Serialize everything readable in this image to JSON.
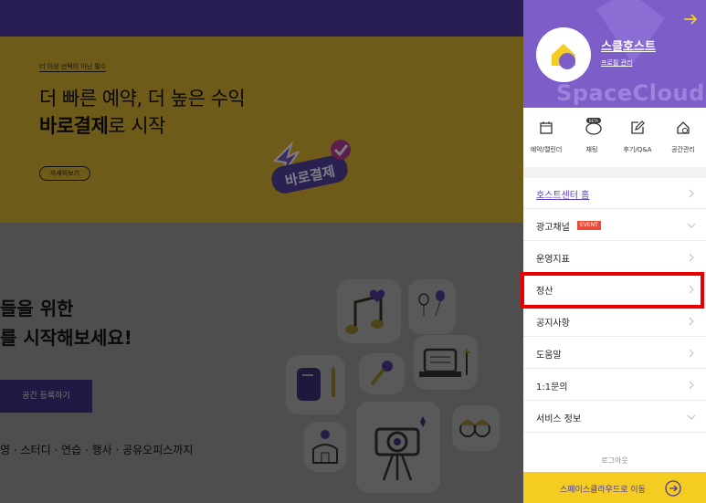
{
  "banner": {
    "tag": "더 이상 선택이 아닌 필수",
    "line1": "더 빠른 예약, 더 높은 수익",
    "line2_bold": "바로결제",
    "line2_rest": "로 시작",
    "more_label": "자세히보기",
    "badge_text": "바로결제"
  },
  "hero": {
    "line1": "들을 위한",
    "line2": "를 시작해보세요!",
    "register_label": "공간 등록하기",
    "categories": "영 · 스터디 · 연습 · 행사 · 공유오피스까지"
  },
  "panel": {
    "host_name": "스클호스트",
    "profile_label": "프로필 관리",
    "watermark": "SpaceCloud",
    "quick": [
      {
        "label": "예약/캘린더",
        "icon": "calendar-icon"
      },
      {
        "label": "채팅",
        "icon": "chat-icon",
        "badge": "BETA"
      },
      {
        "label": "후기/Q&A",
        "icon": "edit-icon"
      },
      {
        "label": "공간관리",
        "icon": "home-settings-icon"
      }
    ],
    "menu": [
      {
        "label": "호스트센터 홈",
        "chevron": "right"
      },
      {
        "label": "광고채널",
        "chevron": "down",
        "badge": "EVENT"
      },
      {
        "label": "운영지표",
        "chevron": "right"
      },
      {
        "label": "정산",
        "chevron": "right"
      },
      {
        "label": "공지사항",
        "chevron": "right"
      },
      {
        "label": "도움말",
        "chevron": "right"
      },
      {
        "label": "1:1문의",
        "chevron": "right"
      },
      {
        "label": "서비스 정보",
        "chevron": "down"
      }
    ],
    "logout_label": "로그아웃",
    "go_label": "스페이스클라우드로 이동"
  },
  "colors": {
    "purple": "#7d5ec9",
    "yellow": "#f5cd22",
    "highlight": "#e80000"
  }
}
